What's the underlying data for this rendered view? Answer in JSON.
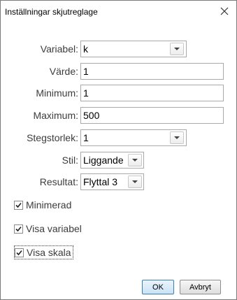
{
  "dialog": {
    "title": "Inställningar skjutreglage",
    "close_icon": "close-icon"
  },
  "fields": {
    "variable": {
      "label": "Variabel:",
      "value": "k"
    },
    "value": {
      "label": "Värde:",
      "value": "1"
    },
    "minimum": {
      "label": "Minimum:",
      "value": "1"
    },
    "maximum": {
      "label": "Maximum:",
      "value": "500"
    },
    "step": {
      "label": "Stegstorlek:",
      "value": "1"
    },
    "style": {
      "label": "Stil:",
      "value": "Liggande"
    },
    "result": {
      "label": "Resultat:",
      "value": "Flyttal 3"
    }
  },
  "checkboxes": {
    "minimized": {
      "label": "Minimerad",
      "checked": true
    },
    "show_variable": {
      "label": "Visa variabel",
      "checked": true
    },
    "show_scale": {
      "label": "Visa skala",
      "checked": true
    }
  },
  "buttons": {
    "ok": "OK",
    "cancel": "Avbryt"
  },
  "colors": {
    "default_button_border": "#3c7fb1",
    "label_text": "#3c3c3c"
  }
}
